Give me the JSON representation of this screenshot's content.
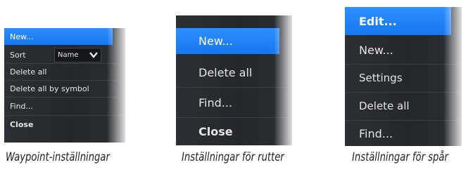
{
  "waypoint_menu": {
    "items": [
      {
        "label": "New...",
        "selected": true
      },
      {
        "label": "Sort"
      },
      {
        "label": "Delete all"
      },
      {
        "label": "Delete all by symbol"
      },
      {
        "label": "Find..."
      },
      {
        "label": "Close",
        "bold": true
      }
    ],
    "sort_value": "Name",
    "caption": "Waypoint-inställningar"
  },
  "route_menu": {
    "items": [
      {
        "label": "New...",
        "selected": true
      },
      {
        "label": "Delete all"
      },
      {
        "label": "Find..."
      },
      {
        "label": "Close",
        "bold": true
      }
    ],
    "caption": "Inställningar för rutter"
  },
  "track_menu": {
    "items": [
      {
        "label": "Edit...",
        "selected": true,
        "bold": true
      },
      {
        "label": "New..."
      },
      {
        "label": "Settings"
      },
      {
        "label": "Delete all"
      },
      {
        "label": "Find..."
      }
    ],
    "caption": "Inställningar för spår"
  },
  "colors": {
    "highlight": "#1b7ff5",
    "menu_bg": "#26292d",
    "text": "#e6e6e6"
  }
}
